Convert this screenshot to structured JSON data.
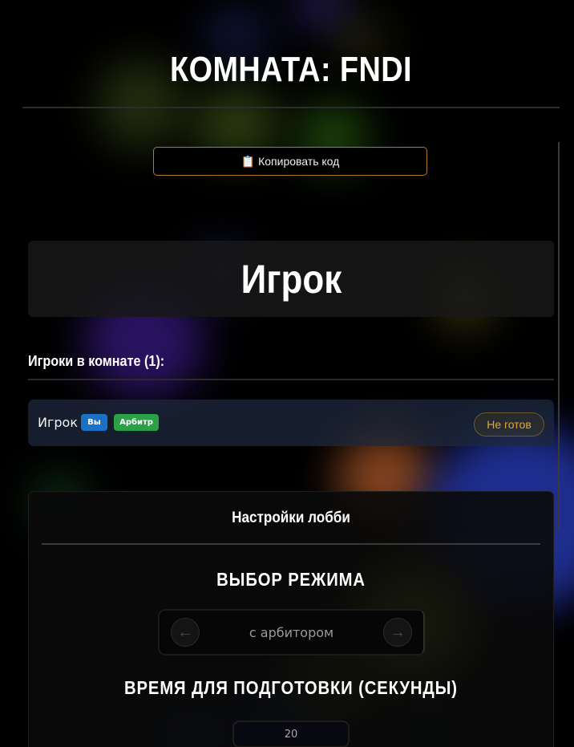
{
  "room": {
    "title": "КОМНАТА: FNDI",
    "copy_button_icon": "clipboard-icon",
    "copy_button_label": "Копировать код"
  },
  "role": {
    "title": "Игрок"
  },
  "players": {
    "heading": "Игроки в комнате (1):",
    "list": [
      {
        "name": "Игрок",
        "badges": [
          "Вы",
          "Арбитр"
        ],
        "status": "Не готов"
      }
    ]
  },
  "settings": {
    "title": "Настройки лобби",
    "mode": {
      "title": "ВЫБОР РЕЖИМА",
      "value": "с арбитором",
      "prev_icon": "arrow-left-icon",
      "next_icon": "arrow-right-icon"
    },
    "prep_time": {
      "title": "ВРЕМЯ ДЛЯ ПОДГОТОВКИ (СЕКУНДЫ)",
      "value": "20"
    }
  },
  "colors": {
    "badge_you": "#1a72c8",
    "badge_arbiter": "#2aa146",
    "status_not_ready": "#e0a92a",
    "copy_button_border": "#b07a2a"
  }
}
